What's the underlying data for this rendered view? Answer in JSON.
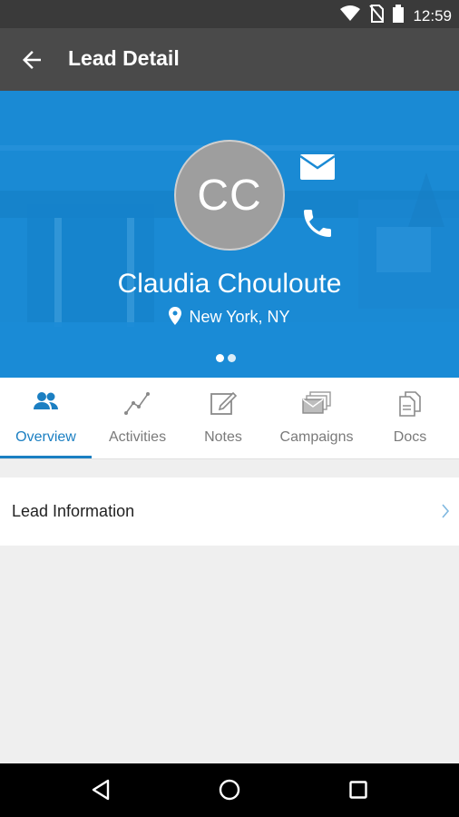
{
  "status_bar": {
    "time": "12:59",
    "icons": [
      "wifi-icon",
      "no-sim-icon",
      "battery-icon"
    ]
  },
  "app_bar": {
    "title": "Lead Detail",
    "back_icon": "arrow-left-icon"
  },
  "lead": {
    "initials": "CC",
    "name": "Claudia Chouloute",
    "location": "New York, NY",
    "actions": [
      "mail-icon",
      "phone-icon"
    ],
    "pager": {
      "pages": 2,
      "current": 1
    }
  },
  "tabs": [
    {
      "label": "Overview",
      "icon": "people-icon",
      "active": true
    },
    {
      "label": "Activities",
      "icon": "activity-chart-icon",
      "active": false
    },
    {
      "label": "Notes",
      "icon": "notes-icon",
      "active": false
    },
    {
      "label": "Campaigns",
      "icon": "campaigns-icon",
      "active": false
    },
    {
      "label": "Docs",
      "icon": "docs-icon",
      "active": false
    }
  ],
  "sections": [
    {
      "label": "Lead Information",
      "icon": "chevron-right-icon"
    }
  ],
  "colors": {
    "accent": "#1b7fc2",
    "hero_bg": "#1a8ad4",
    "app_bar": "#4a4a4a",
    "avatar_bg": "#9e9e9e"
  },
  "nav_bar": {
    "buttons": [
      "back-triangle-icon",
      "home-circle-icon",
      "recents-square-icon"
    ]
  }
}
